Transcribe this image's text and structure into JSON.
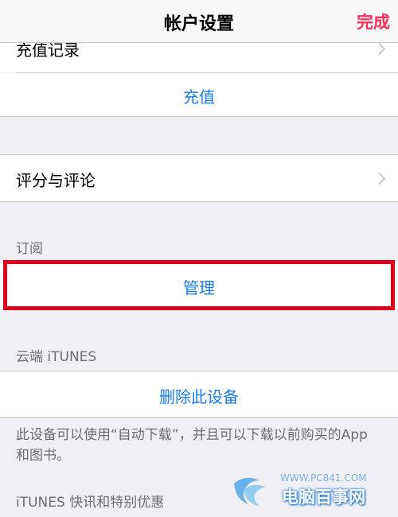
{
  "navbar": {
    "title": "帐户设置",
    "done_label": "完成"
  },
  "rows": {
    "recharge_history": "充值记录",
    "recharge": "充值",
    "ratings_reviews": "评分与评论",
    "manage": "管理",
    "remove_device": "删除此设备"
  },
  "sections": {
    "subscriptions": "订阅",
    "itunes_cloud": "云端 iTUNES",
    "itunes_news": "iTUNES 快讯和特别优惠"
  },
  "footer": {
    "device_note": "此设备可以使用“自动下载”，并且可以下载以前购买的App 和图书。"
  },
  "watermark": {
    "url": "WWW.PC841.COM",
    "name": "电脑百事网"
  },
  "colors": {
    "accent_blue": "#1a7cf0",
    "done_pink": "#ff2d55",
    "highlight_red": "#e0001e",
    "background": "#efeff4"
  }
}
